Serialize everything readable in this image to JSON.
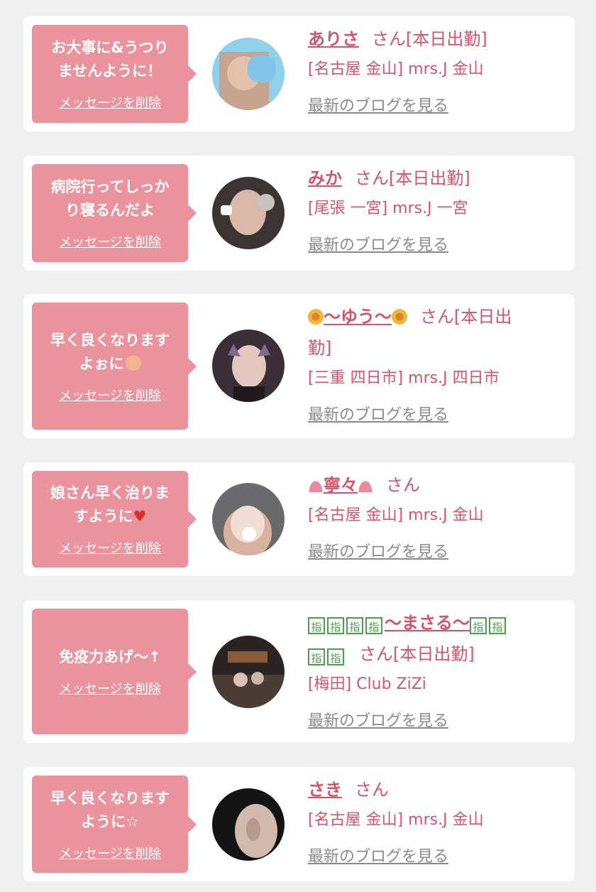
{
  "colors": {
    "background": "#f0f0f0",
    "card": "#ffffff",
    "bubble": "#eb939d",
    "accent_text": "#d2566b",
    "blog_link": "#8a8a8a"
  },
  "cards": [
    {
      "message_lines": [
        "お大事に&うつり",
        "ませんように！"
      ],
      "delete_label": "メッセージを削除",
      "name": "ありさ",
      "suffix": "さん[本日出勤]",
      "shop": "[名古屋 金山] mrs.J 金山",
      "blog_label": "最新のブログを見る"
    },
    {
      "message_lines": [
        "病院行ってしっか",
        "り寝るんだよ"
      ],
      "delete_label": "メッセージを削除",
      "name": "みか",
      "suffix": "さん[本日出勤]",
      "shop": "[尾張 一宮] mrs.J 一宮",
      "blog_label": "最新のブログを見る"
    },
    {
      "message_lines": [
        "早く良くなります",
        "よぉに"
      ],
      "delete_label": "メッセージを削除",
      "name": "〜ゆう〜",
      "suffix_line1": "さん[本日出",
      "suffix_line2": "勤]",
      "shop": "[三重 四日市] mrs.J 四日市",
      "blog_label": "最新のブログを見る"
    },
    {
      "message_lines": [
        "娘さん早く治りま",
        "すように"
      ],
      "delete_label": "メッセージを削除",
      "name": "寧々",
      "suffix": "さん",
      "shop": "[名古屋 金山] mrs.J 金山",
      "blog_label": "最新のブログを見る"
    },
    {
      "message_lines": [
        "免疫力あげ〜↑"
      ],
      "delete_label": "メッセージを削除",
      "finger_glyph": "指",
      "name": "〜まさる〜",
      "suffix": "さん[本日出勤]",
      "shop": "[梅田] Club ZiZi",
      "blog_label": "最新のブログを見る"
    },
    {
      "message_lines": [
        "早く良くなります",
        "ように☆"
      ],
      "delete_label": "メッセージを削除",
      "name": "さき",
      "suffix": "さん",
      "shop": "[名古屋 金山] mrs.J 金山",
      "blog_label": "最新のブログを見る"
    }
  ]
}
